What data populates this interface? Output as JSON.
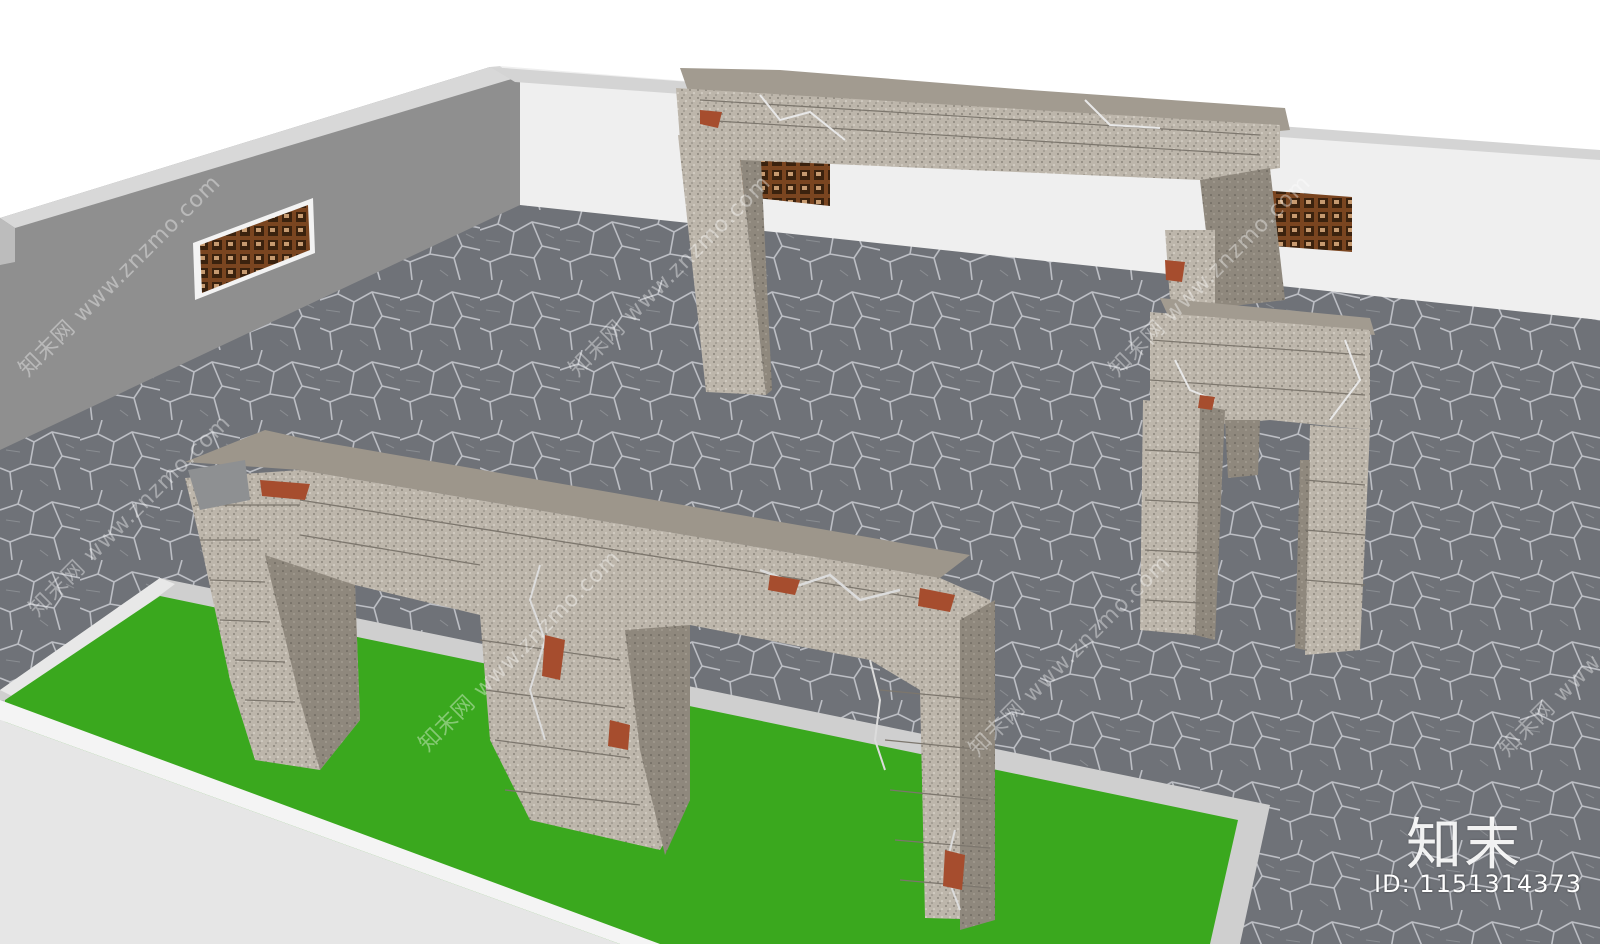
{
  "scene": {
    "colors": {
      "floor": "#6f7278",
      "floor_crack": "#c9ccd1",
      "wall_left": "#8e8e8e",
      "wall_back": "#eeeeee",
      "wall_top": "#d9d9d9",
      "grass": "#39a81c",
      "stone": "#b9b2a7",
      "stone_dark": "#8e877c",
      "stone_shadow": "#6f6a62",
      "brick": "#a64d2e",
      "window_frame": "#6a3a16"
    }
  },
  "watermark": {
    "site_text": "知末网 www.znzmo.com",
    "brand": "知末",
    "id_text": "ID: 1151314373"
  }
}
